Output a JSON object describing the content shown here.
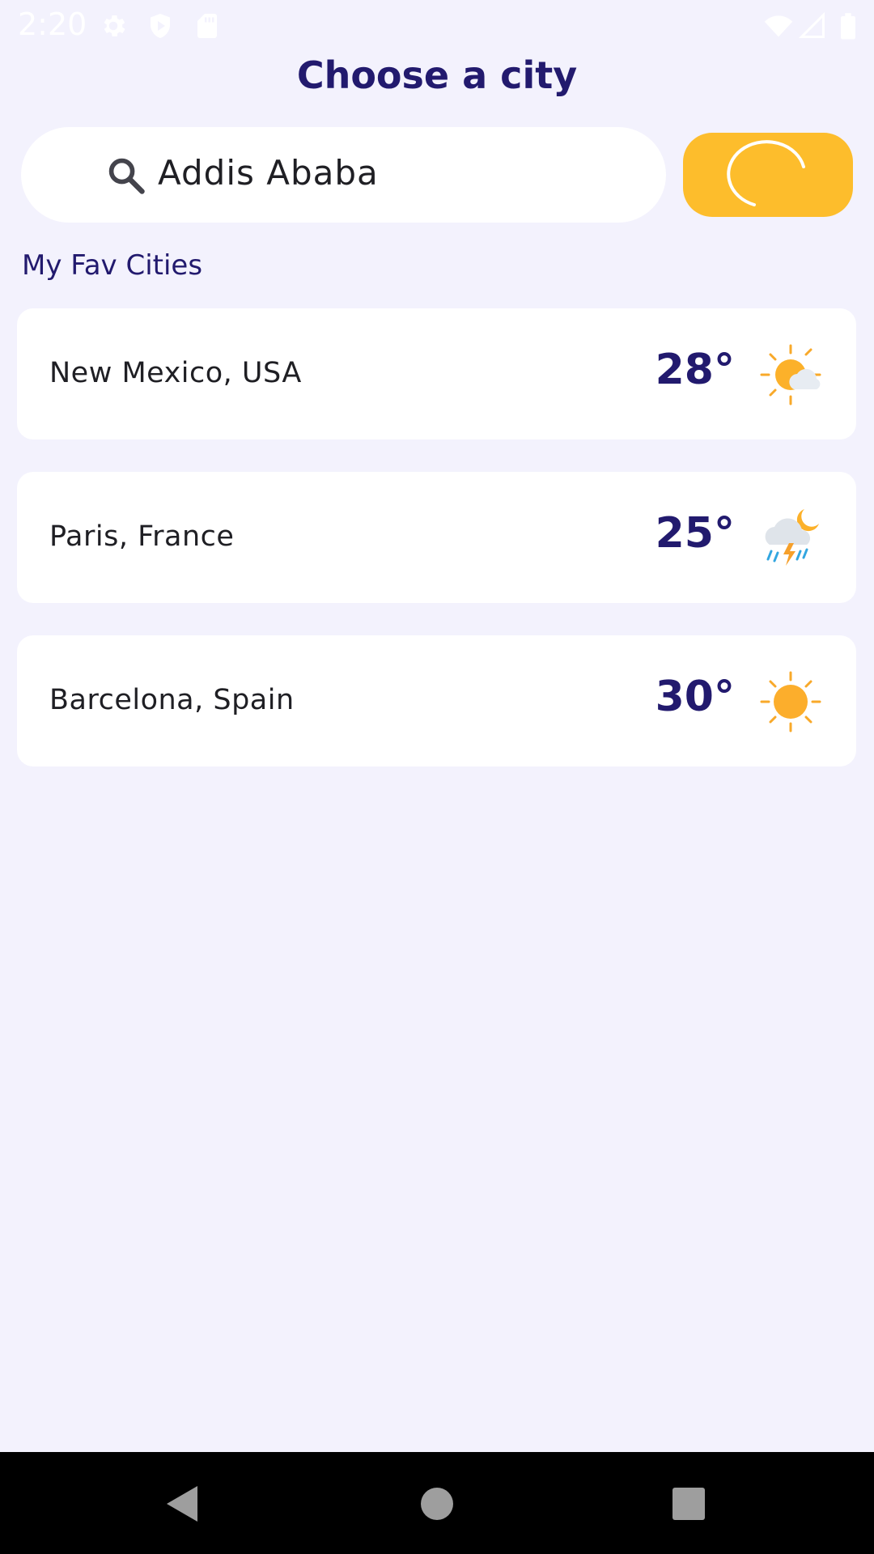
{
  "status_bar": {
    "time": "2:20",
    "icons": [
      "settings-icon",
      "shield-icon",
      "sd-card-icon",
      "wifi-icon",
      "signal-icon",
      "battery-icon"
    ]
  },
  "header": {
    "title": "Choose a city"
  },
  "search": {
    "value": "Addis Ababa",
    "icon": "search-icon"
  },
  "refresh_button": {
    "icon": "loading-spinner-icon",
    "color": "#fdbd2c"
  },
  "favorites": {
    "label": "My Fav Cities",
    "cities": [
      {
        "name": "New Mexico, USA",
        "temp": "28°",
        "icon": "partly-sunny-icon"
      },
      {
        "name": "Paris, France",
        "temp": "25°",
        "icon": "thunderstorm-night-icon"
      },
      {
        "name": "Barcelona, Spain",
        "temp": "30°",
        "icon": "sunny-icon"
      }
    ]
  },
  "nav_bar": {
    "buttons": [
      "back-icon",
      "home-icon",
      "recents-icon"
    ]
  },
  "colors": {
    "background": "#f3f2fd",
    "primary_text": "#221a6e",
    "accent": "#fdbd2c",
    "card": "#ffffff"
  }
}
